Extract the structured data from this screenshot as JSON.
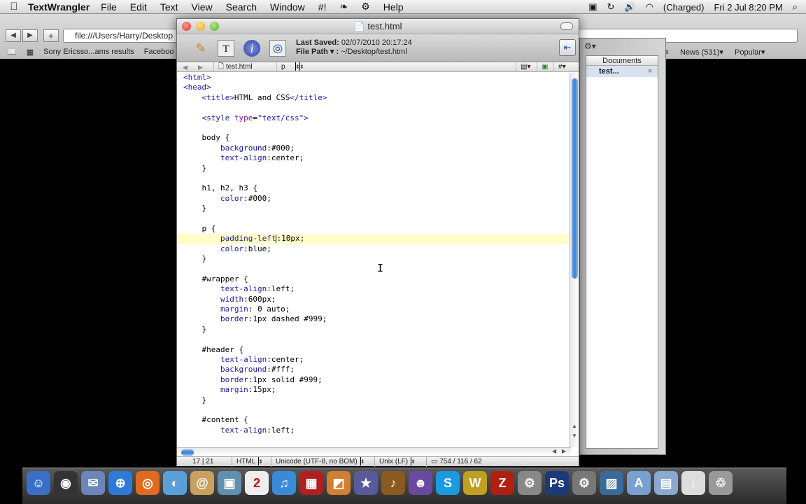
{
  "menubar": {
    "apple": "",
    "app_name": "TextWrangler",
    "items": [
      "File",
      "Edit",
      "Text",
      "View",
      "Search",
      "Window",
      "#!",
      "",
      "",
      "Help"
    ],
    "battery": "(Charged)",
    "clock": "Fri 2 Jul   8:20 PM"
  },
  "browser": {
    "url": "file:///Users/Harry/Desktop",
    "bookmarks": [
      "Sony Ericsso...ams results",
      "Faceboo",
      "a",
      "News (531)▾",
      "Popular▾"
    ]
  },
  "drawer": {
    "header": "Documents",
    "doc": "test..."
  },
  "window": {
    "title": "test.html",
    "last_saved_label": "Last Saved:",
    "last_saved": "02/07/2010 20:17:24",
    "file_path_label": "File Path ▾ :",
    "file_path": "~/Desktop/test.html",
    "nav_file": "test.html",
    "nav_func": "p",
    "nav_hash": "#",
    "status": {
      "position": "17 | 21",
      "language": "HTML",
      "encoding": "Unicode (UTF-8, no BOM)",
      "line_endings": "Unix (LF)",
      "stats": "754 / 116 / 62"
    }
  },
  "code_lines": [
    "<html>",
    "<head>",
    "    <title>HTML and CSS</title>",
    "",
    "    <style type=\"text/css\">",
    "",
    "    body {",
    "        background:#000;",
    "        text-align:center;",
    "    }",
    "",
    "    h1, h2, h3 {",
    "        color:#000;",
    "    }",
    "",
    "    p {",
    "        padding-left:10px;",
    "        color:blue;",
    "    }",
    "",
    "    #wrapper {",
    "        text-align:left;",
    "        width:600px;",
    "        margin: 0 auto;",
    "        border:1px dashed #999;",
    "    }",
    "",
    "    #header {",
    "        text-align:center;",
    "        background:#fff;",
    "        border:1px solid #999;",
    "        margin:15px;",
    "    }",
    "",
    "    #content {",
    "        text-align:left;"
  ],
  "highlight_line": 17,
  "colors": {
    "highlight": "#ffffc8",
    "tag": "#1a1aa6",
    "desktop": "#000000"
  },
  "dock_icons": [
    "finder-icon",
    "dashboard-icon",
    "mail-icon",
    "safari-icon",
    "firefox-icon",
    "facetime-icon",
    "address-book-icon",
    "iphoto-icon",
    "ical-icon",
    "itunes-icon",
    "photo-booth-icon",
    "preview-icon",
    "imovie-icon",
    "garageband-icon",
    "ichat-icon",
    "skype-icon",
    "world-of-warcraft-icon",
    "filezilla-icon",
    "system-preferences-icon",
    "photoshop-icon",
    "settings-icon",
    "screenshots-icon",
    "applications-folder-icon",
    "documents-folder-icon",
    "downloads-icon",
    "trash-icon"
  ]
}
